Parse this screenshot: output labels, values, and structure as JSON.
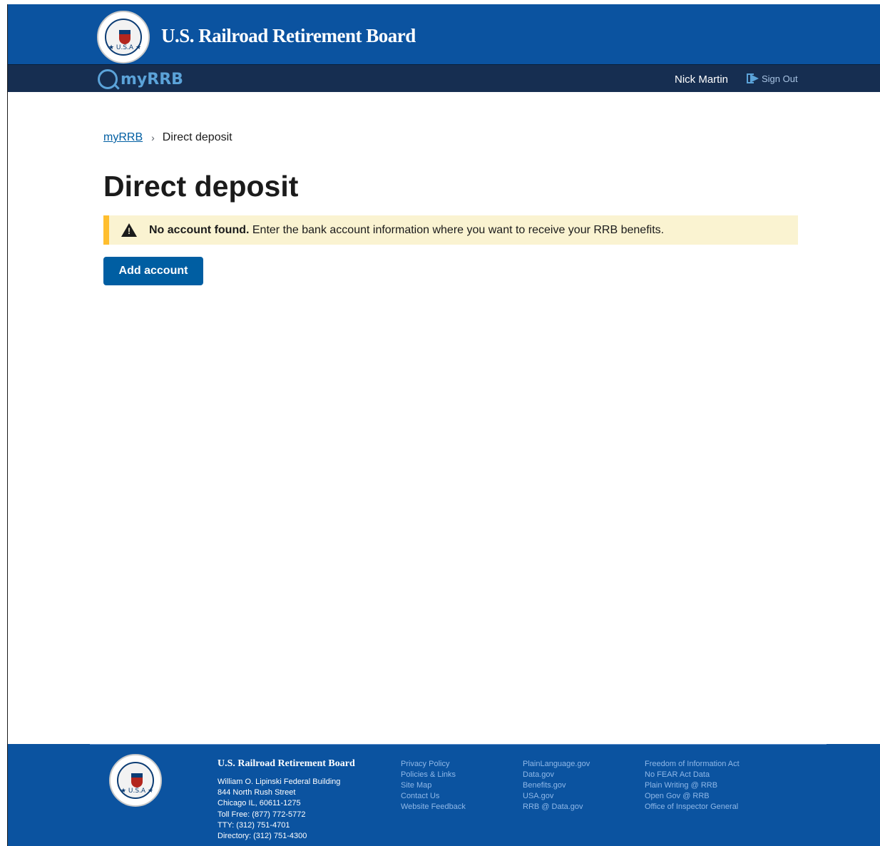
{
  "header": {
    "site_title": "U.S. Railroad Retirement Board",
    "seal_text": "★ U.S.A ★",
    "app_logo_text": "myRRB",
    "user_name": "Nick Martin",
    "sign_out_label": "Sign Out"
  },
  "breadcrumb": {
    "home_label": "myRRB",
    "separator": "›",
    "current_label": "Direct deposit"
  },
  "main": {
    "page_title": "Direct deposit",
    "alert": {
      "title": "No account found.",
      "message": " Enter the bank account information where you want to receive your RRB benefits."
    },
    "add_account_label": "Add account"
  },
  "footer": {
    "org_name": "U.S. Railroad Retirement Board",
    "address_lines": [
      "William O. Lipinski Federal Building",
      "844 North Rush Street",
      "Chicago IL, 60611-1275",
      "Toll Free: (877) 772-5772",
      "TTY: (312) 751-4701",
      "Directory: (312) 751-4300"
    ],
    "links_col1": [
      "Privacy Policy",
      "Policies & Links",
      "Site Map",
      "Contact Us",
      "Website Feedback"
    ],
    "links_col2": [
      "PlainLanguage.gov",
      "Data.gov",
      "Benefits.gov",
      "USA.gov",
      "RRB @ Data.gov"
    ],
    "links_col3": [
      "Freedom of Information Act",
      "No FEAR Act Data",
      "Plain Writing @ RRB",
      "Open Gov @ RRB",
      "Office of Inspector General"
    ]
  },
  "colors": {
    "header_blue": "#0b53a0",
    "nav_navy": "#162e51",
    "link_blue": "#005ea2",
    "alert_bg": "#faf3d1",
    "alert_border": "#ffbe2e"
  }
}
